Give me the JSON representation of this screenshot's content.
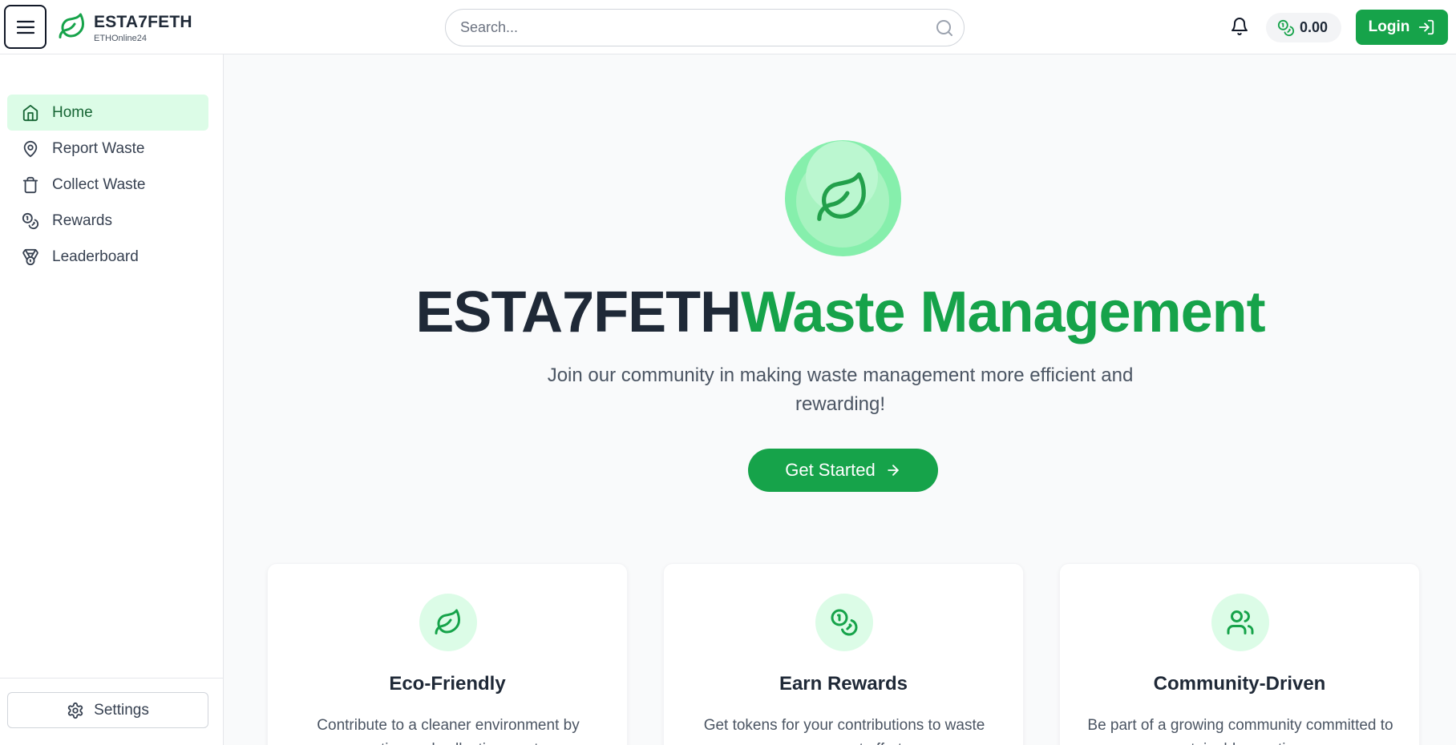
{
  "header": {
    "brand_name": "ESTA7FETH",
    "brand_sub": "ETHOnline24",
    "search_placeholder": "Search...",
    "balance": "0.00",
    "login_label": "Login"
  },
  "sidebar": {
    "items": [
      {
        "label": "Home",
        "icon": "home-icon",
        "active": true
      },
      {
        "label": "Report Waste",
        "icon": "map-pin-icon"
      },
      {
        "label": "Collect Waste",
        "icon": "trash-icon"
      },
      {
        "label": "Rewards",
        "icon": "coins-icon"
      },
      {
        "label": "Leaderboard",
        "icon": "medal-icon"
      }
    ],
    "settings_label": "Settings"
  },
  "hero": {
    "title_dark": "ESTA7FETH",
    "title_green": "Waste Management",
    "subtitle": "Join our community in making waste management more efficient and rewarding!",
    "cta_label": "Get Started"
  },
  "features": [
    {
      "title": "Eco-Friendly",
      "text": "Contribute to a cleaner environment by reporting and collecting waste.",
      "icon": "leaf-icon"
    },
    {
      "title": "Earn Rewards",
      "text": "Get tokens for your contributions to waste management efforts.",
      "icon": "coins-icon"
    },
    {
      "title": "Community-Driven",
      "text": "Be part of a growing community committed to sustainable practices.",
      "icon": "users-icon"
    }
  ],
  "colors": {
    "accent": "#16a34a",
    "accent_light": "#dcfce7",
    "text_dark": "#1f2937"
  }
}
